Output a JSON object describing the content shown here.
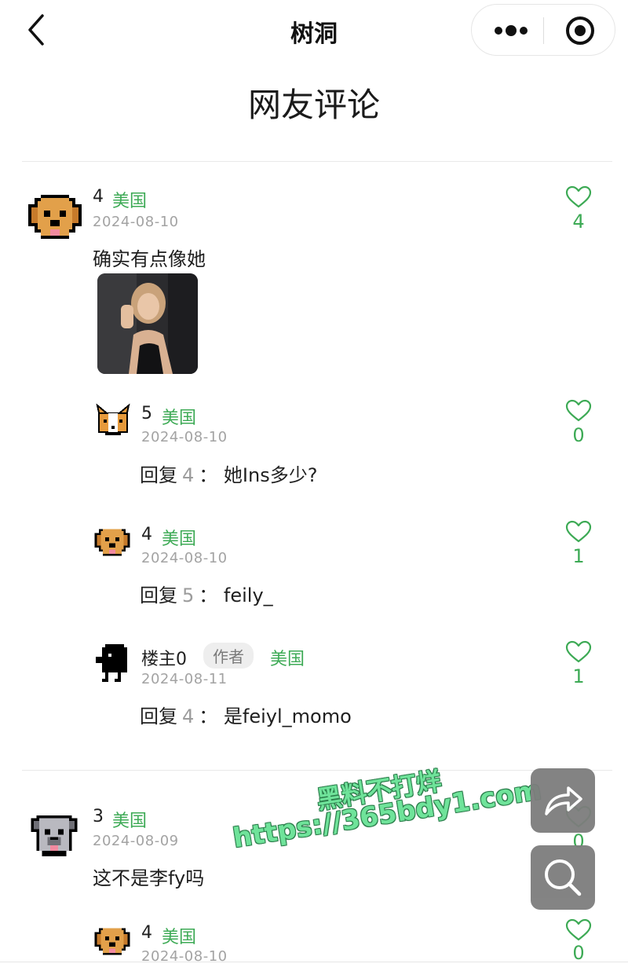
{
  "nav": {
    "title": "树洞"
  },
  "page": {
    "heading": "网友评论"
  },
  "colors": {
    "accent": "#3daa55",
    "date_gray": "#a3a3a3",
    "fab_gray": "#7d7d7d"
  },
  "comments": [
    {
      "name": "4",
      "location": "美国",
      "date": "2024-08-10",
      "content": "确实有点像她",
      "likes": "4",
      "has_photo": true,
      "replies": [
        {
          "name": "5",
          "location": "美国",
          "date": "2024-08-10",
          "reply_prefix": "回复",
          "reply_to": "4",
          "separator": "：",
          "content": "她Ins多少?",
          "likes": "0"
        },
        {
          "name": "4",
          "location": "美国",
          "date": "2024-08-10",
          "reply_prefix": "回复",
          "reply_to": "5",
          "separator": "：",
          "content": "feily_",
          "likes": "1"
        },
        {
          "name": "楼主0",
          "author_tag": "作者",
          "location": "美国",
          "date": "2024-08-11",
          "reply_prefix": "回复",
          "reply_to": "4",
          "separator": "：",
          "content": "是feiyl_momo",
          "likes": "1"
        }
      ]
    },
    {
      "name": "3",
      "location": "美国",
      "date": "2024-08-09",
      "content": "这不是李fy吗",
      "likes": "0",
      "replies": [
        {
          "name": "4",
          "location": "美国",
          "date": "2024-08-10",
          "likes": "0"
        }
      ]
    }
  ],
  "watermark": {
    "line1": "黑料不打烊",
    "line2": "https://365bdy1.com"
  },
  "icons": [
    "back-arrow-icon",
    "more-dots-icon",
    "close-target-icon",
    "heart-icon",
    "share-arrow-icon",
    "search-icon"
  ]
}
